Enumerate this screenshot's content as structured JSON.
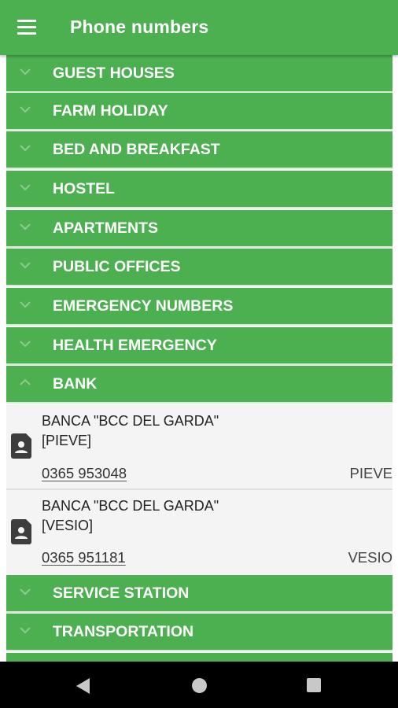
{
  "appbar": {
    "title": "Phone numbers",
    "menu_icon": "hamburger-menu-icon"
  },
  "categories_top": [
    {
      "label": "GUEST HOUSES",
      "expanded": false
    },
    {
      "label": "FARM HOLIDAY",
      "expanded": false
    },
    {
      "label": "BED AND BREAKFAST",
      "expanded": false
    },
    {
      "label": "HOSTEL",
      "expanded": false
    },
    {
      "label": "APARTMENTS",
      "expanded": false
    },
    {
      "label": "PUBLIC OFFICES",
      "expanded": false
    },
    {
      "label": "EMERGENCY NUMBERS",
      "expanded": false
    },
    {
      "label": "HEALTH EMERGENCY",
      "expanded": false
    },
    {
      "label": "BANK",
      "expanded": true
    }
  ],
  "bank_entries": [
    {
      "name_line1": "BANCA \"BCC DEL GARDA\"",
      "name_line2": "[PIEVE]",
      "phone": "0365 953048",
      "location": "PIEVE"
    },
    {
      "name_line1": "BANCA \"BCC DEL GARDA\"",
      "name_line2": "[VESIO]",
      "phone": "0365 951181",
      "location": "VESIO"
    }
  ],
  "categories_bottom": [
    {
      "label": "SERVICE STATION",
      "expanded": false
    },
    {
      "label": "TRANSPORTATION",
      "expanded": false
    }
  ],
  "colors": {
    "accent": "#4caf50",
    "entry_bg": "#f4f4f4",
    "text": "#ffffff"
  },
  "navbar": {
    "back_icon": "back-triangle-icon",
    "home_icon": "home-circle-icon",
    "recents_icon": "recents-square-icon"
  }
}
